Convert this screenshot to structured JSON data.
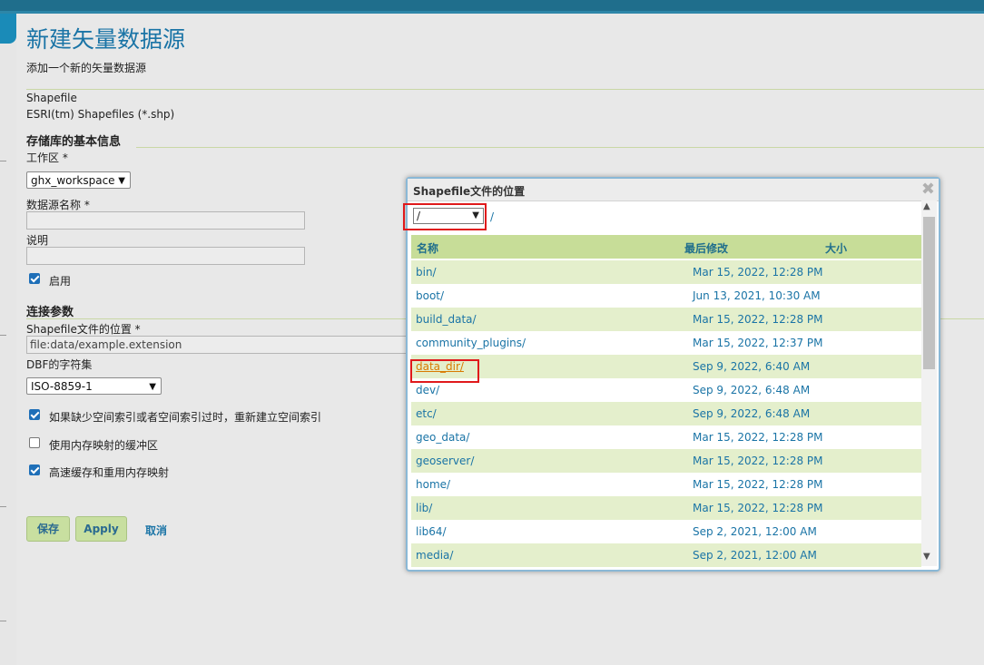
{
  "page": {
    "title": "新建矢量数据源",
    "subtitle": "添加一个新的矢量数据源",
    "type_name": "Shapefile",
    "type_desc": "ESRI(tm) Shapefiles (*.shp)"
  },
  "basic": {
    "section_title": "存储库的基本信息",
    "workspace_label": "工作区 *",
    "workspace_value": "ghx_workspace",
    "name_label": "数据源名称 *",
    "name_value": "",
    "desc_label": "说明",
    "desc_value": "",
    "enabled_label": "启用",
    "enabled": true
  },
  "connection": {
    "section_title": "连接参数",
    "location_label": "Shapefile文件的位置 *",
    "location_value": "file:data/example.extension",
    "charset_label": "DBF的字符集",
    "charset_value": "ISO-8859-1",
    "opt1_label": "如果缺少空间索引或者空间索引过时，重新建立空间索引",
    "opt1": true,
    "opt2_label": "使用内存映射的缓冲区",
    "opt2": false,
    "opt3_label": "高速缓存和重用内存映射",
    "opt3": true
  },
  "actions": {
    "save": "保存",
    "apply": "Apply",
    "cancel": "取消"
  },
  "dialog": {
    "title": "Shapefile文件的位置",
    "close_icon": "close-icon",
    "root_value": "/",
    "path_text": "/",
    "col_name": "名称",
    "col_modified": "最后修改",
    "col_size": "大小",
    "rows": [
      {
        "name": "bin/",
        "date": "Mar 15, 2022, 12:28 PM"
      },
      {
        "name": "boot/",
        "date": "Jun 13, 2021, 10:30 AM"
      },
      {
        "name": "build_data/",
        "date": "Mar 15, 2022, 12:28 PM"
      },
      {
        "name": "community_plugins/",
        "date": "Mar 15, 2022, 12:37 PM"
      },
      {
        "name": "data_dir/",
        "date": "Sep 9, 2022, 6:40 AM"
      },
      {
        "name": "dev/",
        "date": "Sep 9, 2022, 6:48 AM"
      },
      {
        "name": "etc/",
        "date": "Sep 9, 2022, 6:48 AM"
      },
      {
        "name": "geo_data/",
        "date": "Mar 15, 2022, 12:28 PM"
      },
      {
        "name": "geoserver/",
        "date": "Mar 15, 2022, 12:28 PM"
      },
      {
        "name": "home/",
        "date": "Mar 15, 2022, 12:28 PM"
      },
      {
        "name": "lib/",
        "date": "Mar 15, 2022, 12:28 PM"
      },
      {
        "name": "lib64/",
        "date": "Sep 2, 2021, 12:00 AM"
      },
      {
        "name": "media/",
        "date": "Sep 2, 2021, 12:00 AM"
      }
    ]
  },
  "colors": {
    "accent": "#1a74a6",
    "header_green": "#c7dd98",
    "row_alt": "#e4efcc",
    "highlight_box": "#e0191b",
    "hover_link": "#d97a00"
  }
}
